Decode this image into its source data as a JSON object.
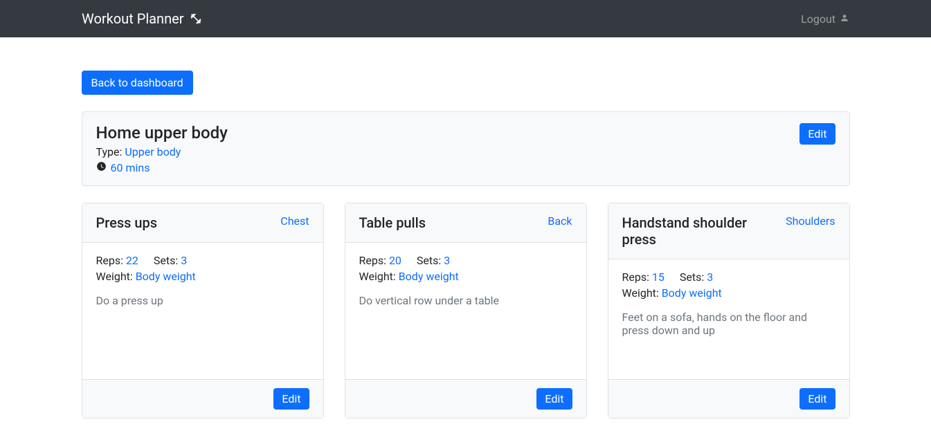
{
  "navbar": {
    "brand": "Workout Planner",
    "logout": "Logout"
  },
  "back_button": "Back to dashboard",
  "workout": {
    "title": "Home upper body",
    "type_label": "Type:",
    "type_value": "Upper body",
    "duration": "60 mins",
    "edit": "Edit"
  },
  "labels": {
    "reps": "Reps:",
    "sets": "Sets:",
    "weight": "Weight:"
  },
  "exercises": [
    {
      "name": "Press ups",
      "muscle": "Chest",
      "reps": "22",
      "sets": "3",
      "weight": "Body weight",
      "description": "Do a press up",
      "edit": "Edit"
    },
    {
      "name": "Table pulls",
      "muscle": "Back",
      "reps": "20",
      "sets": "3",
      "weight": "Body weight",
      "description": "Do vertical row under a table",
      "edit": "Edit"
    },
    {
      "name": "Handstand shoulder press",
      "muscle": "Shoulders",
      "reps": "15",
      "sets": "3",
      "weight": "Body weight",
      "description": "Feet on a sofa, hands on the floor and press down and up",
      "edit": "Edit"
    }
  ]
}
